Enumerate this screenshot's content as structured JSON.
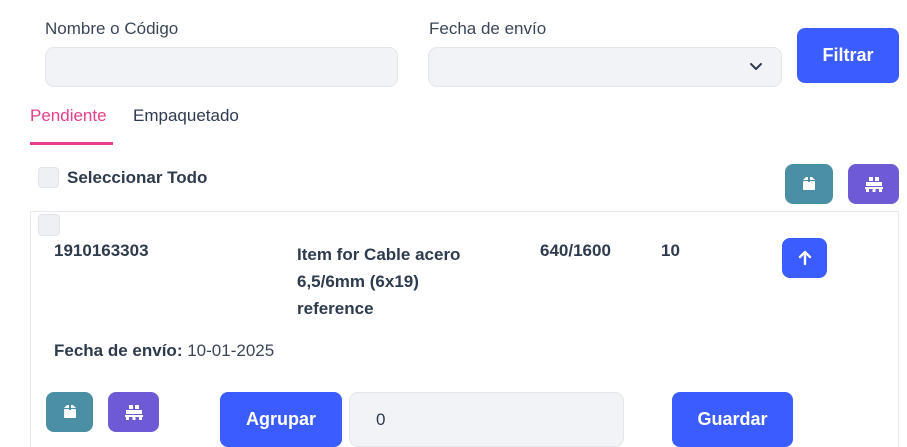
{
  "filters": {
    "name_label": "Nombre o Código",
    "name_value": "",
    "date_label": "Fecha de envío",
    "date_value": "",
    "filter_button": "Filtrar"
  },
  "tabs": [
    {
      "label": "Pendiente",
      "active": true
    },
    {
      "label": "Empaquetado",
      "active": false
    }
  ],
  "toolbar": {
    "select_all_label": "Seleccionar Todo",
    "box_icon": "box-icon",
    "pallet_icon": "pallet-icon"
  },
  "item": {
    "code": "1910163303",
    "description_lines": [
      "Item for Cable acero",
      "6,5/6mm (6x19)",
      "reference"
    ],
    "ratio": "640/1600",
    "quantity": "10",
    "ship_date_label": "Fecha de envío:",
    "ship_date_value": "10-01-2025",
    "group_button": "Agrupar",
    "group_value": "0",
    "save_button": "Guardar"
  },
  "colors": {
    "accent": "#3b5cff",
    "tab_active": "#e83e8c",
    "teal": "#4a8fa3",
    "purple": "#6f5ad6"
  }
}
